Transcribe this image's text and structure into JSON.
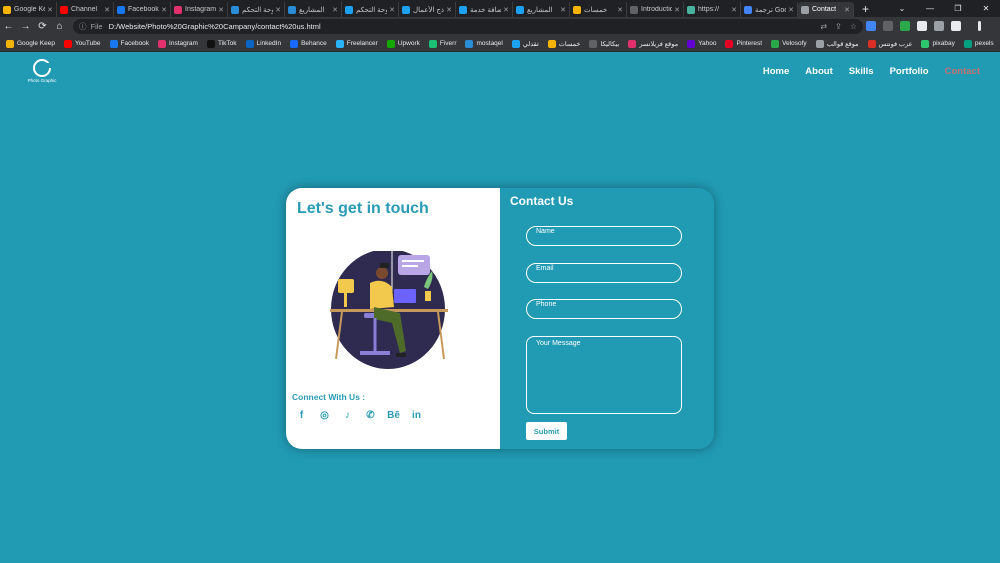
{
  "browser": {
    "tabs": [
      {
        "label": "Google Keep",
        "color": "#f4b400"
      },
      {
        "label": "Channel",
        "color": "#ff0000"
      },
      {
        "label": "Facebook",
        "color": "#1877f2"
      },
      {
        "label": "Instagram",
        "color": "#e1306c"
      },
      {
        "label": "لوحة التحكم",
        "color": "#2a8bd6"
      },
      {
        "label": "المشاريع",
        "color": "#2a8bd6"
      },
      {
        "label": "لوحة التحكم",
        "color": "#1da1f2"
      },
      {
        "label": "نماذج الأعمال",
        "color": "#1da1f2"
      },
      {
        "label": "إضافة خدمة",
        "color": "#1da1f2"
      },
      {
        "label": "المشاريع",
        "color": "#1da1f2"
      },
      {
        "label": "خمسات",
        "color": "#f5b400"
      },
      {
        "label": "Introduction",
        "color": "#5f6368"
      },
      {
        "label": "https://",
        "color": "#4ab3a0"
      },
      {
        "label": "ترجمة Google",
        "color": "#4285f4"
      },
      {
        "label": "Contact",
        "color": "#9aa0a6",
        "active": true
      }
    ],
    "new_tab": "+",
    "window_controls": [
      "⌄",
      "—",
      "❐",
      "✕"
    ],
    "nav": {
      "back": "←",
      "forward": "→",
      "reload": "⟳",
      "home": "⌂"
    },
    "address": {
      "scheme": "File",
      "url": "D:/Website/Photo%20Graphic%20Campany/contact%20us.html"
    },
    "bookmarks": [
      {
        "label": "Google Keep",
        "color": "#f4b400"
      },
      {
        "label": "YouTube",
        "color": "#ff0000"
      },
      {
        "label": "Facebook",
        "color": "#1877f2"
      },
      {
        "label": "Instagram",
        "color": "#e1306c"
      },
      {
        "label": "TikTok",
        "color": "#111111"
      },
      {
        "label": "LinkedIn",
        "color": "#0a66c2"
      },
      {
        "label": "Behance",
        "color": "#1769ff"
      },
      {
        "label": "Freelancer",
        "color": "#29b2fe"
      },
      {
        "label": "Upwork",
        "color": "#14a800"
      },
      {
        "label": "Fiverr",
        "color": "#1dbf73"
      },
      {
        "label": "mostaqel",
        "color": "#2a8bd6"
      },
      {
        "label": "تقدلي",
        "color": "#1da1f2"
      },
      {
        "label": "خمسات",
        "color": "#f5b400"
      },
      {
        "label": "بيكاليكا",
        "color": "#5f6368"
      },
      {
        "label": "موقع فريلانسر",
        "color": "#e1306c"
      },
      {
        "label": "Yahoo",
        "color": "#6001d2"
      },
      {
        "label": "Pinterest",
        "color": "#e60023"
      },
      {
        "label": "Velosofy",
        "color": "#2ba84a"
      },
      {
        "label": "موقع قوالب",
        "color": "#9aa0a6"
      },
      {
        "label": "عرب فونتس",
        "color": "#d93025"
      },
      {
        "label": "pixabay",
        "color": "#2ec66d"
      },
      {
        "label": "pexels",
        "color": "#05a081"
      }
    ]
  },
  "site": {
    "logo_text": "Photo Graphic",
    "nav": [
      "Home",
      "About",
      "Skills",
      "Portfolio",
      "Contact"
    ],
    "active_nav": "Contact",
    "touch_title": "Let's get in touch",
    "connect_label": "Connect With Us :",
    "socials": [
      {
        "name": "facebook",
        "glyph": "f"
      },
      {
        "name": "instagram",
        "glyph": "◎"
      },
      {
        "name": "tiktok",
        "glyph": "♪"
      },
      {
        "name": "whatsapp",
        "glyph": "✆"
      },
      {
        "name": "behance",
        "glyph": "Bē"
      },
      {
        "name": "linkedin",
        "glyph": "in"
      }
    ],
    "contact_title": "Contact Us",
    "form": {
      "name_placeholder": "Name",
      "email_placeholder": "Email",
      "phone_placeholder": "Phone",
      "message_placeholder": "Your Message",
      "submit_label": "Submit"
    },
    "colors": {
      "background": "#219ab3",
      "accent": "#2a9bb4",
      "active_link": "#c47272"
    }
  }
}
